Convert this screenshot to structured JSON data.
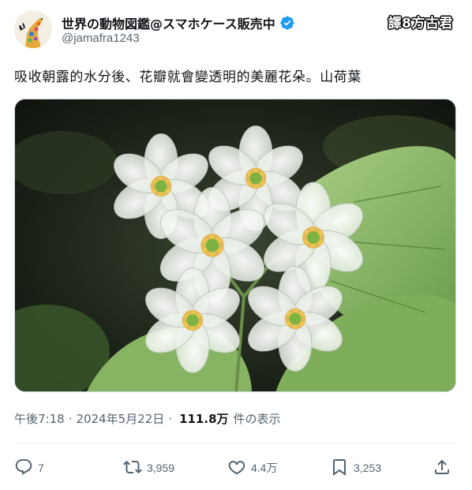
{
  "account": {
    "display_name": "世界の動物図鑑@スマホケース販売中",
    "handle": "@jamafra1243",
    "verified": true,
    "verified_color": "#1d9bf0"
  },
  "watermark": "譯8方古君",
  "tweet": {
    "text": "吸收朝露的水分後、花瓣就會變透明的美麗花朵。山荷葉"
  },
  "meta": {
    "time": "午後7:18",
    "date": "2024年5月22日",
    "views_count": "111.8万",
    "views_label": "件の表示",
    "separator": "·"
  },
  "actions": {
    "replies": "7",
    "reposts": "3,959",
    "likes": "4.4万",
    "bookmarks": "3,253"
  },
  "icons": {
    "reply": "reply-icon",
    "repost": "repost-icon",
    "like": "heart-icon",
    "bookmark": "bookmark-icon",
    "share": "share-icon",
    "verified": "verified-badge-icon"
  },
  "colors": {
    "text_primary": "#0f1419",
    "text_secondary": "#536471",
    "divider": "#eff3f4"
  }
}
